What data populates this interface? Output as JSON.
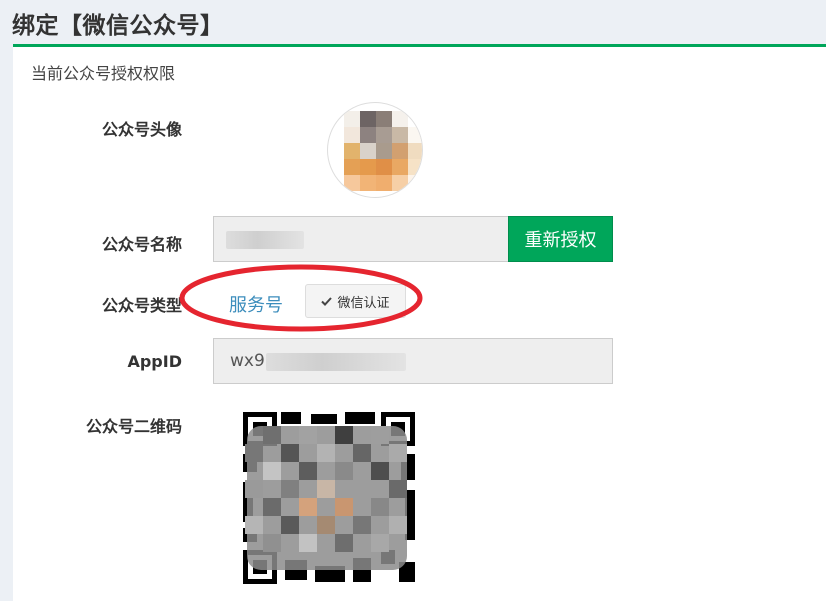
{
  "page": {
    "title": "绑定【微信公众号】"
  },
  "box": {
    "title": "当前公众号授权权限"
  },
  "fields": {
    "avatar_label": "公众号头像",
    "name_label": "公众号名称",
    "type_label": "公众号类型",
    "appid_label": "AppID",
    "qrcode_label": "公众号二维码"
  },
  "values": {
    "appid_prefix": "wx9",
    "account_type": "服务号",
    "verified_badge": "微信认证"
  },
  "actions": {
    "reauthorize": "重新授权"
  },
  "colors": {
    "accent_green": "#00a65a",
    "link_blue": "#3c8dbc",
    "annotation_red": "#e5252f"
  },
  "icons": {
    "verified": "check-icon"
  }
}
